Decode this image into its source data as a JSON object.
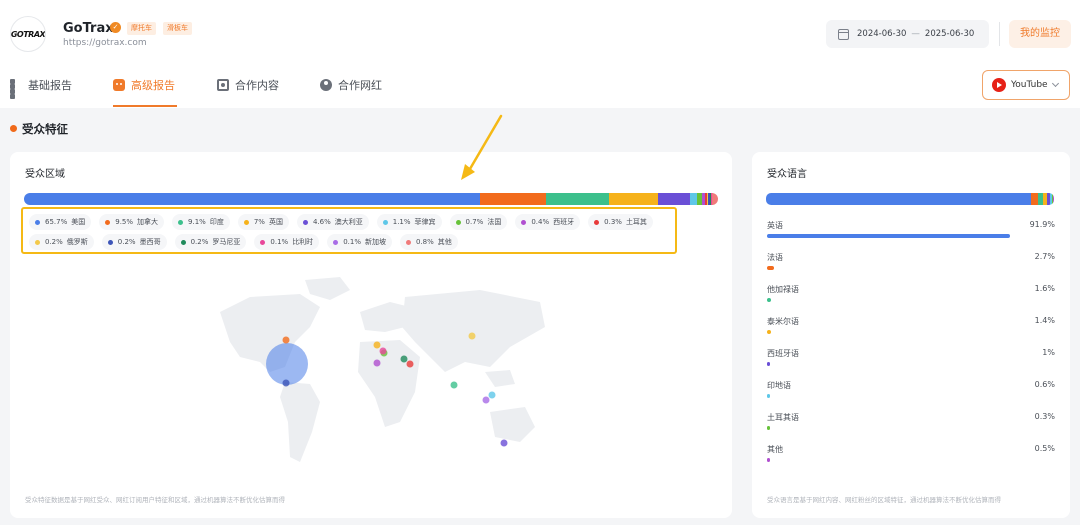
{
  "brand": {
    "logo_text": "GOTRAX",
    "name": "GoTrax",
    "tags": [
      "摩托车",
      "滑板车"
    ],
    "url": "https://gotrax.com"
  },
  "date_range": {
    "start": "2024-06-30",
    "separator": "—",
    "end": "2025-06-30"
  },
  "monitor_label": "我的监控",
  "tabs": [
    {
      "label": "基础报告",
      "active": false,
      "icon": "grid-icon"
    },
    {
      "label": "高级报告",
      "active": true,
      "icon": "robot-icon"
    },
    {
      "label": "合作内容",
      "active": false,
      "icon": "content-icon"
    },
    {
      "label": "合作网红",
      "active": false,
      "icon": "person-icon"
    }
  ],
  "platform_select": {
    "value": "YouTube",
    "icon": "youtube-icon"
  },
  "section_title": "受众特征",
  "region_card": {
    "title": "受众区域",
    "segments": [
      {
        "label": "美国",
        "pct_text": "65.7%",
        "value": 65.7,
        "color": "#4a7ee8"
      },
      {
        "label": "加拿大",
        "pct_text": "9.5%",
        "value": 9.5,
        "color": "#f26b1d"
      },
      {
        "label": "印度",
        "pct_text": "9.1%",
        "value": 9.1,
        "color": "#3cc08c"
      },
      {
        "label": "英国",
        "pct_text": "7%",
        "value": 7.0,
        "color": "#f6b21b"
      },
      {
        "label": "澳大利亚",
        "pct_text": "4.6%",
        "value": 4.6,
        "color": "#6a4fd6"
      },
      {
        "label": "菲律宾",
        "pct_text": "1.1%",
        "value": 1.1,
        "color": "#5ec7e8"
      },
      {
        "label": "法国",
        "pct_text": "0.7%",
        "value": 0.7,
        "color": "#67c23a"
      },
      {
        "label": "西班牙",
        "pct_text": "0.4%",
        "value": 0.4,
        "color": "#b04fd0"
      },
      {
        "label": "土耳其",
        "pct_text": "0.3%",
        "value": 0.3,
        "color": "#e83a3a"
      },
      {
        "label": "俄罗斯",
        "pct_text": "0.2%",
        "value": 0.2,
        "color": "#f3c94a"
      },
      {
        "label": "墨西哥",
        "pct_text": "0.2%",
        "value": 0.2,
        "color": "#3d55b8"
      },
      {
        "label": "罗马尼亚",
        "pct_text": "0.2%",
        "value": 0.2,
        "color": "#1f8a5b"
      },
      {
        "label": "比利时",
        "pct_text": "0.1%",
        "value": 0.1,
        "color": "#e8479a"
      },
      {
        "label": "新加坡",
        "pct_text": "0.1%",
        "value": 0.1,
        "color": "#a86ce6"
      },
      {
        "label": "其他",
        "pct_text": "0.8%",
        "value": 0.8,
        "color": "#f07a7a"
      }
    ],
    "footnote": "受众特征数据是基于网红受众、网红订阅用户特征和区域，通过机器算法不断优化估算而得"
  },
  "language_card": {
    "title": "受众语言",
    "rows": [
      {
        "label": "英语",
        "pct_text": "91.9%",
        "value": 91.9,
        "color": "#4a7ee8"
      },
      {
        "label": "法语",
        "pct_text": "2.7%",
        "value": 2.7,
        "color": "#f26b1d"
      },
      {
        "label": "他加禄语",
        "pct_text": "1.6%",
        "value": 1.6,
        "color": "#3cc08c"
      },
      {
        "label": "泰米尔语",
        "pct_text": "1.4%",
        "value": 1.4,
        "color": "#f6b21b"
      },
      {
        "label": "西班牙语",
        "pct_text": "1%",
        "value": 1.0,
        "color": "#6a4fd6"
      },
      {
        "label": "印地语",
        "pct_text": "0.6%",
        "value": 0.6,
        "color": "#5ec7e8"
      },
      {
        "label": "土耳其语",
        "pct_text": "0.3%",
        "value": 0.3,
        "color": "#67c23a"
      },
      {
        "label": "其他",
        "pct_text": "0.5%",
        "value": 0.5,
        "color": "#b04fd0"
      }
    ],
    "footnote": "受众语言是基于网红内容、网红粉丝的区域特征，通过机器算法不断优化估算而得"
  }
}
